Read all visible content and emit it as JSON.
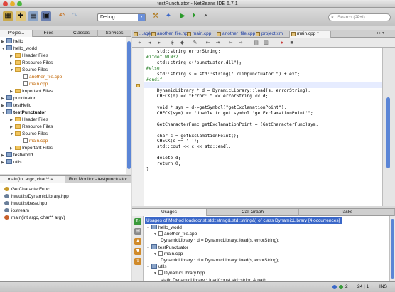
{
  "window": {
    "title": "testPunctuator - NetBeans IDE 6.7.1"
  },
  "toolbar": {
    "configuration": "Debug",
    "search_placeholder": "Search (⌘+I)"
  },
  "projects_panel": {
    "tabs": [
      "Projec...",
      "Files",
      "Classes",
      "Services"
    ],
    "tree": [
      {
        "label": "hello",
        "depth": 0,
        "expanded": false,
        "icon": "project"
      },
      {
        "label": "hello_world",
        "depth": 0,
        "expanded": true,
        "icon": "project"
      },
      {
        "label": "Header Files",
        "depth": 1,
        "expanded": false,
        "icon": "folder"
      },
      {
        "label": "Resource Files",
        "depth": 1,
        "expanded": false,
        "icon": "folder"
      },
      {
        "label": "Source Files",
        "depth": 1,
        "expanded": true,
        "icon": "folder"
      },
      {
        "label": "another_file.cpp",
        "depth": 2,
        "icon": "file",
        "style": "orange"
      },
      {
        "label": "main.cpp",
        "depth": 2,
        "icon": "file",
        "style": "orange"
      },
      {
        "label": "Important Files",
        "depth": 1,
        "expanded": false,
        "icon": "folder"
      },
      {
        "label": "punctuator",
        "depth": 0,
        "expanded": false,
        "icon": "project"
      },
      {
        "label": "testHello",
        "depth": 0,
        "expanded": false,
        "icon": "project"
      },
      {
        "label": "testPunctuator",
        "depth": 0,
        "expanded": true,
        "icon": "project",
        "style": "bold"
      },
      {
        "label": "Header Files",
        "depth": 1,
        "expanded": false,
        "icon": "folder"
      },
      {
        "label": "Resource Files",
        "depth": 1,
        "expanded": false,
        "icon": "folder"
      },
      {
        "label": "Source Files",
        "depth": 1,
        "expanded": true,
        "icon": "folder"
      },
      {
        "label": "main.cpp",
        "depth": 2,
        "icon": "file",
        "style": "orange"
      },
      {
        "label": "Important Files",
        "depth": 1,
        "expanded": false,
        "icon": "folder"
      },
      {
        "label": "testWorld",
        "depth": 0,
        "expanded": false,
        "icon": "project"
      },
      {
        "label": "utils",
        "depth": 0,
        "expanded": false,
        "icon": "project"
      }
    ]
  },
  "navigator": {
    "tabs": [
      "main(int argc, char** a...",
      "Run Monitor - testpunctuator"
    ],
    "items": [
      {
        "label": "GetCharacterFunc",
        "icon": "type"
      },
      {
        "label": "hw/utils/DynamicLibrary.hpp",
        "icon": "include"
      },
      {
        "label": "hw/utils/base.hpp",
        "icon": "include"
      },
      {
        "label": "iostream",
        "icon": "include"
      },
      {
        "label": "main(int argc, char** argv)",
        "icon": "function"
      }
    ]
  },
  "editor": {
    "tabs": [
      {
        "label": "...age",
        "active": false
      },
      {
        "label": "another_file.hpp",
        "active": false
      },
      {
        "label": "main.cpp",
        "active": false
      },
      {
        "label": "another_file.cpp",
        "active": false
      },
      {
        "label": "project.xml",
        "active": false
      },
      {
        "label": "main.cpp *",
        "active": true
      }
    ],
    "lines": [
      {
        "text": "    std::string errorString;",
        "cls": ""
      },
      {
        "text": "#ifdef WIN32",
        "cls": "pp"
      },
      {
        "text": "    std::string s(\"punctuator.dll\");",
        "cls": ""
      },
      {
        "text": "#else",
        "cls": "pp"
      },
      {
        "text": "    std::string s = std::string(\"./libpunctuator.\") + ext;",
        "cls": ""
      },
      {
        "text": "#endif",
        "cls": "pp"
      },
      {
        "text": "",
        "cls": "cur"
      },
      {
        "text": "    DynamicLibrary * d = DynamicLibrary::load(s, errorString);",
        "cls": ""
      },
      {
        "text": "    CHECK(d) << \"Error: \" << errorString << d;",
        "cls": ""
      },
      {
        "text": "",
        "cls": ""
      },
      {
        "text": "    void * sym = d->getSymbol(\"getExclamationPoint\");",
        "cls": ""
      },
      {
        "text": "    CHECK(sym) << \"Unable to get symbol 'getExclamationPoint'\";",
        "cls": ""
      },
      {
        "text": "",
        "cls": ""
      },
      {
        "text": "    GetCharacterFunc getExclamationPoint = (GetCharacterFunc)sym;",
        "cls": ""
      },
      {
        "text": "",
        "cls": ""
      },
      {
        "text": "    char c = getExclamationPoint();",
        "cls": ""
      },
      {
        "text": "    CHECK(c == '!');",
        "cls": ""
      },
      {
        "text": "    std::cout << c << std::endl;",
        "cls": ""
      },
      {
        "text": "",
        "cls": ""
      },
      {
        "text": "    delete d;",
        "cls": ""
      },
      {
        "text": "    return 0;",
        "cls": ""
      },
      {
        "text": "}",
        "cls": ""
      }
    ]
  },
  "bottom": {
    "tabs": [
      "Usages",
      "Call Graph",
      "Tasks"
    ],
    "header": "Usages of Method load(const std::string&,std::string&) of class DynamicLibrary [4 occurrences]",
    "rows": [
      {
        "label": "hello_world",
        "depth": 0,
        "icon": "project"
      },
      {
        "label": "another_file.cpp",
        "depth": 1,
        "icon": "file"
      },
      {
        "label": "DynamicLibrary * d = DynamicLibrary::load(s, errorString);",
        "depth": 2,
        "icon": ""
      },
      {
        "label": "testPunctuator",
        "depth": 0,
        "icon": "project"
      },
      {
        "label": "main.cpp",
        "depth": 1,
        "icon": "file"
      },
      {
        "label": "DynamicLibrary * d = DynamicLibrary::load(s, errorString);",
        "depth": 2,
        "icon": ""
      },
      {
        "label": "utils",
        "depth": 0,
        "icon": "project"
      },
      {
        "label": "DynamicLibrary.hpp",
        "depth": 1,
        "icon": "file"
      },
      {
        "label": "static DynamicLibrary * load(const std::string & path,",
        "depth": 2,
        "icon": ""
      }
    ]
  },
  "status": {
    "count": "2",
    "position": "24 | 1",
    "mode": "INS"
  },
  "colors": {
    "accent": "#3a67c8",
    "scroll": "#5b85d6"
  }
}
